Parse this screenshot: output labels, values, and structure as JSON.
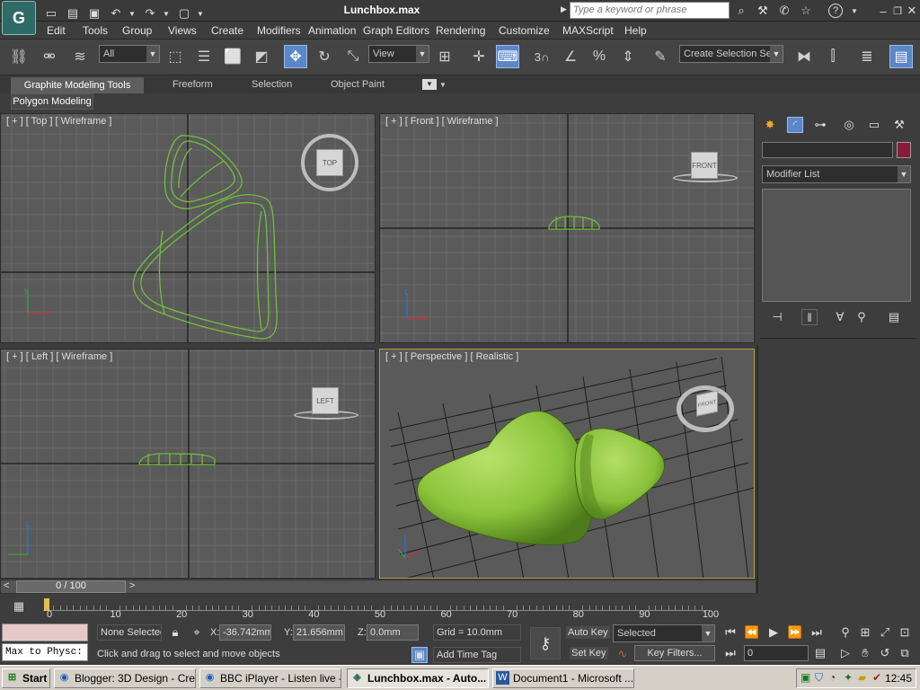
{
  "window": {
    "title": "Lunchbox.max",
    "search_placeholder": "Type a keyword or phrase"
  },
  "menu": [
    "Edit",
    "Tools",
    "Group",
    "Views",
    "Create",
    "Modifiers",
    "Animation",
    "Graph Editors",
    "Rendering",
    "Customize",
    "MAXScript",
    "Help"
  ],
  "toolbar": {
    "selection_filter": "All",
    "reference_coord": "View",
    "snap_label": "3",
    "named_selection_placeholder": "Create Selection Se"
  },
  "ribbon": {
    "tabs": [
      "Graphite Modeling Tools",
      "Freeform",
      "Selection",
      "Object Paint"
    ],
    "subpanel": "Polygon Modeling"
  },
  "viewports": {
    "top": {
      "label": "[ + ] [ Top ] [ Wireframe ]",
      "cube": "TOP"
    },
    "front": {
      "label": "[ + ] [ Front ] [ Wireframe ]",
      "cube": "FRONT"
    },
    "left": {
      "label": "[ + ] [ Left ] [ Wireframe ]",
      "cube": "LEFT"
    },
    "perspective": {
      "label": "[ + ] [ Perspective ] [ Realistic ]",
      "cube": "FRONT"
    }
  },
  "command_panel": {
    "modifier_list": "Modifier List",
    "object_color": "#8b1a3a"
  },
  "timeline": {
    "frame_counter": "0 / 100",
    "ticks": [
      "0",
      "10",
      "20",
      "30",
      "40",
      "50",
      "60",
      "70",
      "80",
      "90",
      "100"
    ]
  },
  "status": {
    "selection": "None Selected",
    "x_label": "X:",
    "x_value": "-36.742mm",
    "y_label": "Y:",
    "y_value": "21.656mm",
    "z_label": "Z:",
    "z_value": "0.0mm",
    "grid": "Grid = 10.0mm",
    "prompt": "Click and drag to select and move objects",
    "add_time_tag": "Add Time Tag",
    "auto_key": "Auto Key",
    "set_key": "Set Key",
    "key_mode": "Selected",
    "key_filters": "Key Filters...",
    "frame_field": "0",
    "maxscript_listener": "Max to Physc:"
  },
  "taskbar": {
    "start": "Start",
    "tasks": [
      "Blogger: 3D Design - Cre...",
      "BBC iPlayer - Listen live -...",
      "Lunchbox.max - Auto...",
      "Document1 - Microsoft ..."
    ],
    "clock": "12:45"
  },
  "colors": {
    "accent": "#5b86c7",
    "wire": "#6fc03a",
    "mesh": "#8cc43c"
  }
}
